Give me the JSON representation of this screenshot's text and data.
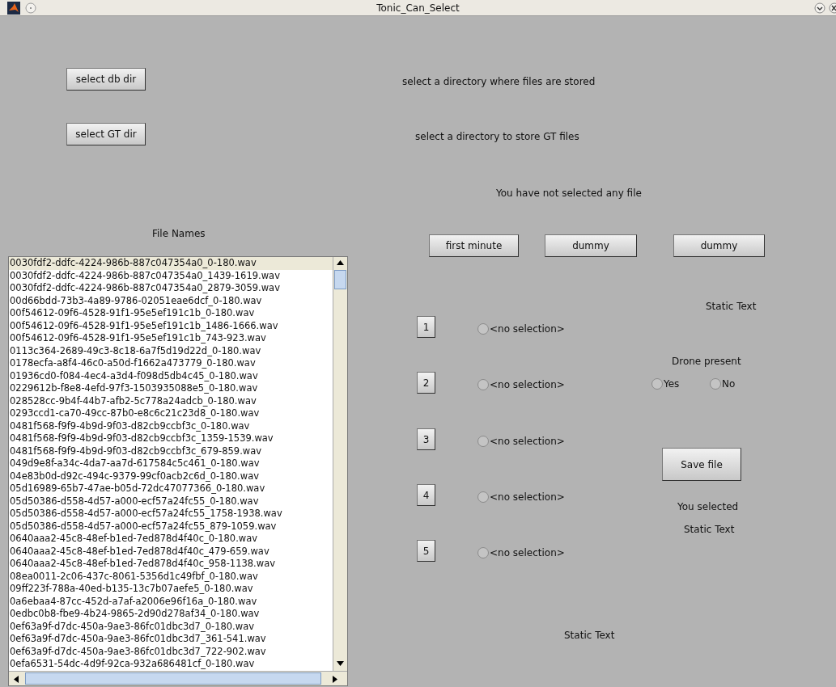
{
  "window": {
    "title": "Tonic_Can_Select"
  },
  "dir_buttons": [
    {
      "label": "select db dir",
      "hint": "select a directory where files are stored"
    },
    {
      "label": "select GT dir",
      "hint": "select a directory to store GT files"
    }
  ],
  "selection_status": "You have not selected any file",
  "file_list": {
    "label": "File Names",
    "items": [
      {
        "name": "0030fdf2-ddfc-4224-986b-887c047354a0_0-180.wav",
        "selected": true
      },
      {
        "name": "0030fdf2-ddfc-4224-986b-887c047354a0_1439-1619.wav",
        "selected": false
      },
      {
        "name": "0030fdf2-ddfc-4224-986b-887c047354a0_2879-3059.wav",
        "selected": false
      },
      {
        "name": "00d66bdd-73b3-4a89-9786-02051eae6dcf_0-180.wav",
        "selected": false
      },
      {
        "name": "00f54612-09f6-4528-91f1-95e5ef191c1b_0-180.wav",
        "selected": false
      },
      {
        "name": "00f54612-09f6-4528-91f1-95e5ef191c1b_1486-1666.wav",
        "selected": false
      },
      {
        "name": "00f54612-09f6-4528-91f1-95e5ef191c1b_743-923.wav",
        "selected": false
      },
      {
        "name": "0113c364-2689-49c3-8c18-6a7f5d19d22d_0-180.wav",
        "selected": false
      },
      {
        "name": "0178ecfa-a8f4-46c0-a50d-f1662a473779_0-180.wav",
        "selected": false
      },
      {
        "name": "01936cd0-f084-4ec4-a3d4-f098d5db4c45_0-180.wav",
        "selected": false
      },
      {
        "name": "0229612b-f8e8-4efd-97f3-1503935088e5_0-180.wav",
        "selected": false
      },
      {
        "name": "028528cc-9b4f-44b7-afb2-5c778a24adcb_0-180.wav",
        "selected": false
      },
      {
        "name": "0293ccd1-ca70-49cc-87b0-e8c6c21c23d8_0-180.wav",
        "selected": false
      },
      {
        "name": "0481f568-f9f9-4b9d-9f03-d82cb9ccbf3c_0-180.wav",
        "selected": false
      },
      {
        "name": "0481f568-f9f9-4b9d-9f03-d82cb9ccbf3c_1359-1539.wav",
        "selected": false
      },
      {
        "name": "0481f568-f9f9-4b9d-9f03-d82cb9ccbf3c_679-859.wav",
        "selected": false
      },
      {
        "name": "049d9e8f-a34c-4da7-aa7d-617584c5c461_0-180.wav",
        "selected": false
      },
      {
        "name": "04e83b0d-d92c-494c-9379-99cf0acb2c6d_0-180.wav",
        "selected": false
      },
      {
        "name": "05d16989-65b7-47ae-b05d-72dc47077366_0-180.wav",
        "selected": false
      },
      {
        "name": "05d50386-d558-4d57-a000-ecf57a24fc55_0-180.wav",
        "selected": false
      },
      {
        "name": "05d50386-d558-4d57-a000-ecf57a24fc55_1758-1938.wav",
        "selected": false
      },
      {
        "name": "05d50386-d558-4d57-a000-ecf57a24fc55_879-1059.wav",
        "selected": false
      },
      {
        "name": "0640aaa2-45c8-48ef-b1ed-7ed878d4f40c_0-180.wav",
        "selected": false
      },
      {
        "name": "0640aaa2-45c8-48ef-b1ed-7ed878d4f40c_479-659.wav",
        "selected": false
      },
      {
        "name": "0640aaa2-45c8-48ef-b1ed-7ed878d4f40c_958-1138.wav",
        "selected": false
      },
      {
        "name": "08ea0011-2c06-437c-8061-5356d1c49fbf_0-180.wav",
        "selected": false
      },
      {
        "name": "09ff223f-788a-40ed-b135-13c7b07aefe5_0-180.wav",
        "selected": false
      },
      {
        "name": "0a6ebaa4-87cc-452d-a7af-a2006e96f16a_0-180.wav",
        "selected": false
      },
      {
        "name": "0edbc0b8-fbe9-4b24-9865-2d90d278af34_0-180.wav",
        "selected": false
      },
      {
        "name": "0ef63a9f-d7dc-450a-9ae3-86fc01dbc3d7_0-180.wav",
        "selected": false
      },
      {
        "name": "0ef63a9f-d7dc-450a-9ae3-86fc01dbc3d7_361-541.wav",
        "selected": false
      },
      {
        "name": "0ef63a9f-d7dc-450a-9ae3-86fc01dbc3d7_722-902.wav",
        "selected": false
      },
      {
        "name": "0efa6531-54dc-4d9f-92ca-932a686481cf_0-180.wav",
        "selected": false
      }
    ]
  },
  "segment_buttons": [
    "first minute",
    "dummy",
    "dummy"
  ],
  "static_text_top": "Static Text",
  "segments": [
    {
      "number": "1",
      "label": "<no selection>",
      "selected": false
    },
    {
      "number": "2",
      "label": "<no selection>",
      "selected": false
    },
    {
      "number": "3",
      "label": "<no selection>",
      "selected": false
    },
    {
      "number": "4",
      "label": "<no selection>",
      "selected": false
    },
    {
      "number": "5",
      "label": "<no selection>",
      "selected": false
    }
  ],
  "drone": {
    "label": "Drone present",
    "options": [
      {
        "label": "Yes",
        "selected": false
      },
      {
        "label": "No",
        "selected": false
      }
    ]
  },
  "save_button": "Save file",
  "you_selected": {
    "label": "You selected",
    "value": "Static Text"
  },
  "static_text_bottom": "Static Text"
}
